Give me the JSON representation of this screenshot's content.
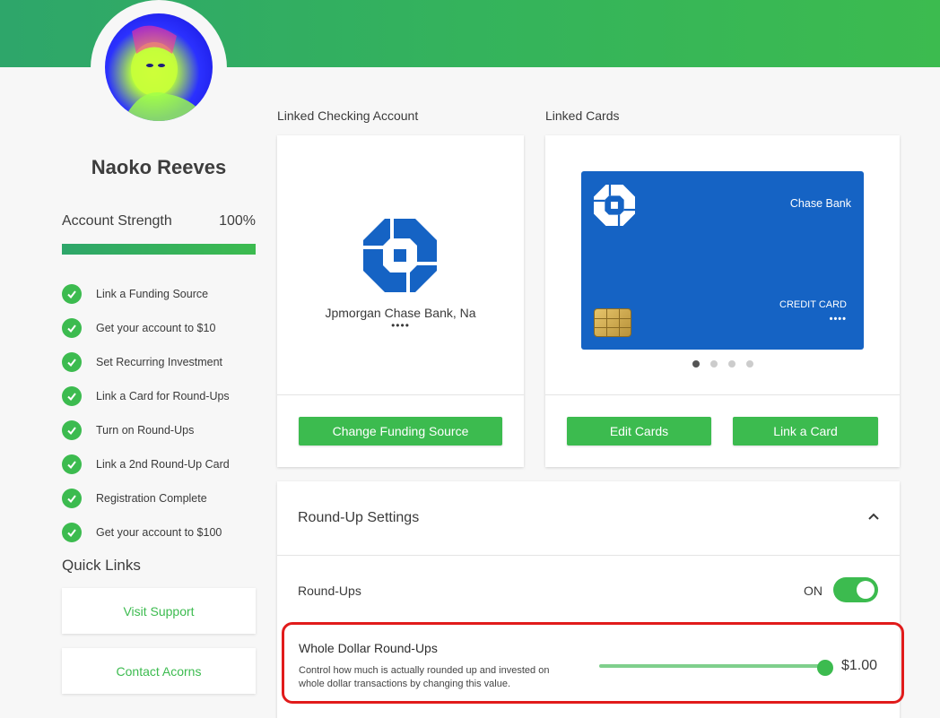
{
  "profile": {
    "name": "Naoko Reeves",
    "avatar_alt": "profile photo"
  },
  "account_strength": {
    "label": "Account Strength",
    "value_text": "100%",
    "value": 1.0
  },
  "checklist": [
    {
      "label": "Link a Funding Source",
      "done": true
    },
    {
      "label": "Get your account to $10",
      "done": true
    },
    {
      "label": "Set Recurring Investment",
      "done": true
    },
    {
      "label": "Link a Card for Round-Ups",
      "done": true
    },
    {
      "label": "Turn on Round-Ups",
      "done": true
    },
    {
      "label": "Link a 2nd Round-Up Card",
      "done": true
    },
    {
      "label": "Registration Complete",
      "done": true
    },
    {
      "label": "Get your account to $100",
      "done": true
    }
  ],
  "quick_links": {
    "title": "Quick Links",
    "items": [
      {
        "label": "Visit Support"
      },
      {
        "label": "Contact Acorns"
      }
    ]
  },
  "checking": {
    "section_label": "Linked Checking Account",
    "bank_name": "Jpmorgan Chase Bank, Na",
    "masked": "••••",
    "button": "Change Funding Source"
  },
  "cards": {
    "section_label": "Linked Cards",
    "card": {
      "bank": "Chase Bank",
      "type": "CREDIT CARD",
      "masked": "••••"
    },
    "carousel_count": 4,
    "carousel_active": 0,
    "edit_button": "Edit Cards",
    "link_button": "Link a Card"
  },
  "roundup_settings": {
    "title": "Round-Up Settings",
    "roundups_label": "Round-Ups",
    "roundups_state": "ON",
    "whole_dollar": {
      "title": "Whole Dollar Round-Ups",
      "description": "Control how much is actually rounded up and invested on whole dollar transactions by changing this value.",
      "value_text": "$1.00",
      "value": 1.0
    }
  },
  "colors": {
    "brand_green": "#3cbb4f",
    "chase_blue": "#1563c4",
    "highlight_red": "#e11b1b"
  }
}
